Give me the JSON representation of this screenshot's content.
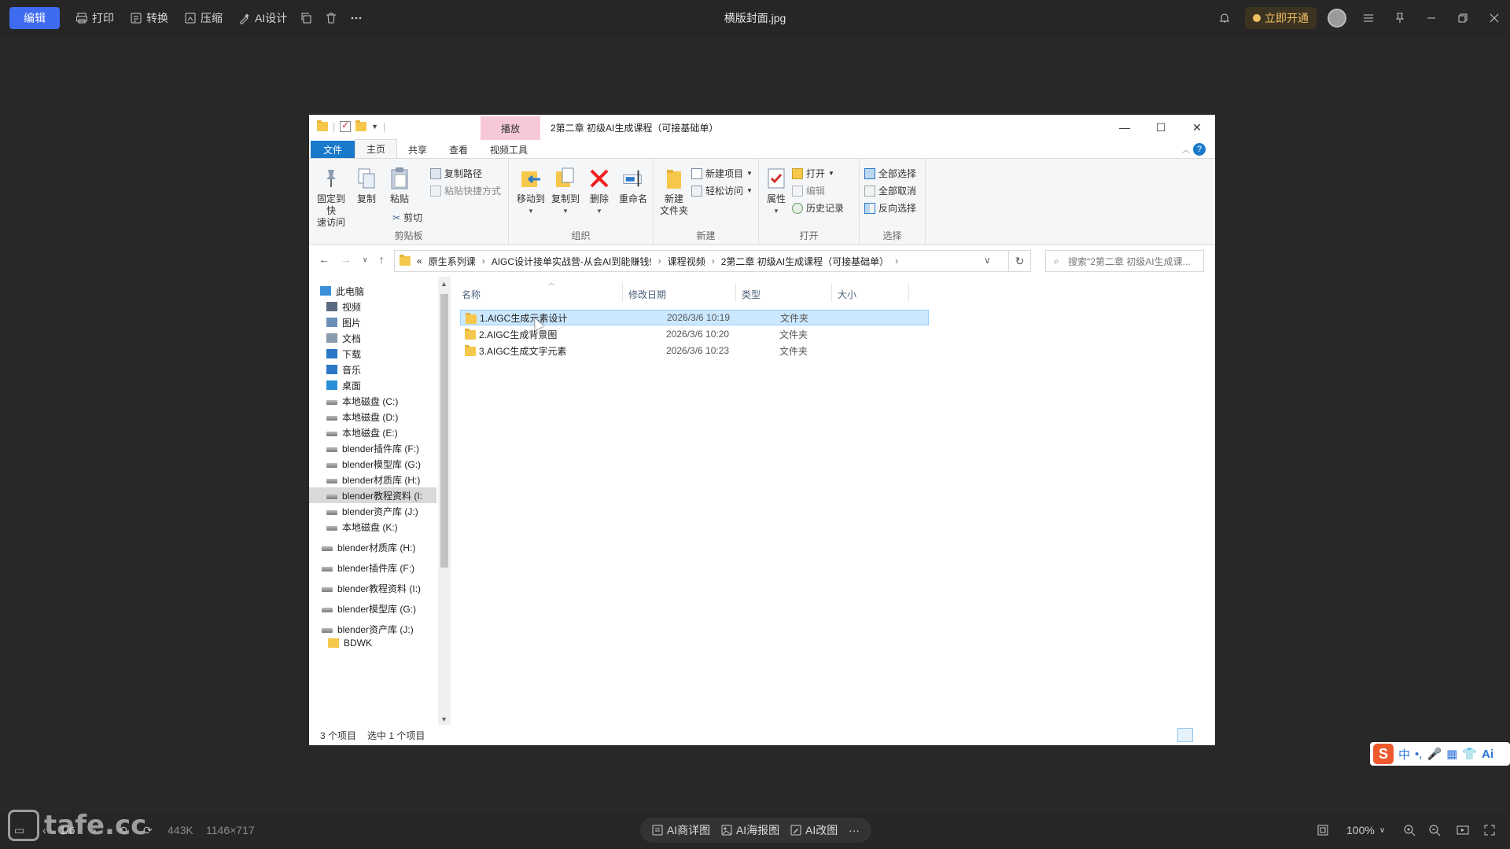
{
  "viewer": {
    "edit_label": "编辑",
    "tools": [
      "打印",
      "转换",
      "压缩",
      "AI设计"
    ],
    "file_title": "横版封面.jpg",
    "vip_label": "立即开通",
    "page_indicator": "1/6",
    "file_size": "443K",
    "dimensions": "1146×717",
    "ai_buttons": [
      "AI商详图",
      "AI海报图",
      "AI改图"
    ],
    "zoom": "100%",
    "watermark": "tafe.cc"
  },
  "explorer": {
    "context_tab": "播放",
    "window_title": "2第二章 初级AI生成课程（可接基础单）",
    "tabs": [
      "文件",
      "主页",
      "共享",
      "查看",
      "视频工具"
    ],
    "ribbon": {
      "clipboard": {
        "pin": "固定到快\n速访问",
        "copy": "复制",
        "paste": "粘贴",
        "copy_path": "复制路径",
        "paste_shortcut": "粘贴快捷方式",
        "cut": "剪切",
        "group": "剪贴板"
      },
      "organize": {
        "move_to": "移动到",
        "copy_to": "复制到",
        "delete": "删除",
        "rename": "重命名",
        "group": "组织"
      },
      "new": {
        "new_folder": "新建\n文件夹",
        "new_item": "新建项目",
        "easy_access": "轻松访问",
        "group": "新建"
      },
      "open": {
        "properties": "属性",
        "open": "打开",
        "edit": "编辑",
        "history": "历史记录",
        "group": "打开"
      },
      "select": {
        "select_all": "全部选择",
        "select_none": "全部取消",
        "invert": "反向选择",
        "group": "选择"
      }
    },
    "address": [
      "«",
      "原生系列课",
      "AIGC设计接单实战营-从会AI到能赚钱!",
      "课程视频",
      "2第二章 初级AI生成课程（可接基础单）"
    ],
    "search_placeholder": "搜索\"2第二章 初级AI生成课...",
    "nav": [
      {
        "label": "此电脑",
        "icon": "pc-icon"
      },
      {
        "label": "视频",
        "icon": "video-icon"
      },
      {
        "label": "图片",
        "icon": "picture-icon"
      },
      {
        "label": "文档",
        "icon": "document-icon"
      },
      {
        "label": "下载",
        "icon": "download-icon"
      },
      {
        "label": "音乐",
        "icon": "music-icon"
      },
      {
        "label": "桌面",
        "icon": "desktop-icon"
      },
      {
        "label": "本地磁盘 (C:)",
        "icon": "drive-icon"
      },
      {
        "label": "本地磁盘 (D:)",
        "icon": "drive-icon"
      },
      {
        "label": "本地磁盘 (E:)",
        "icon": "drive-icon"
      },
      {
        "label": "blender插件库 (F:)",
        "icon": "drive-icon"
      },
      {
        "label": "blender模型库 (G:)",
        "icon": "drive-icon"
      },
      {
        "label": "blender材质库 (H:)",
        "icon": "drive-icon"
      },
      {
        "label": "blender教程资料 (I:",
        "icon": "drive-icon"
      },
      {
        "label": "blender资产库 (J:)",
        "icon": "drive-icon"
      },
      {
        "label": "本地磁盘 (K:)",
        "icon": "drive-icon"
      },
      {
        "label": "blender材质库 (H:)",
        "icon": "drive-icon"
      },
      {
        "label": "blender插件库 (F:)",
        "icon": "drive-icon"
      },
      {
        "label": "blender教程资料 (I:)",
        "icon": "drive-icon"
      },
      {
        "label": "blender模型库 (G:)",
        "icon": "drive-icon"
      },
      {
        "label": "blender资产库 (J:)",
        "icon": "drive-icon"
      },
      {
        "label": "BDWK",
        "icon": "folder-icon"
      }
    ],
    "columns": [
      "名称",
      "修改日期",
      "类型",
      "大小"
    ],
    "files": [
      {
        "name": "1.AIGC生成元素设计",
        "date": "2026/3/6 10:19",
        "type": "文件夹"
      },
      {
        "name": "2.AIGC生成背景图",
        "date": "2026/3/6 10:20",
        "type": "文件夹"
      },
      {
        "name": "3.AIGC生成文字元素",
        "date": "2026/3/6 10:23",
        "type": "文件夹"
      }
    ],
    "status_count": "3 个项目",
    "status_selected": "选中 1 个项目"
  },
  "ime": {
    "lang": "中",
    "punct": "•,",
    "ai": "Ai"
  },
  "colors": {
    "accent": "#3f6bf0",
    "explorer_blue": "#1979ca",
    "vip_gold": "#f0c060",
    "context_pink": "#f7c8d8"
  }
}
